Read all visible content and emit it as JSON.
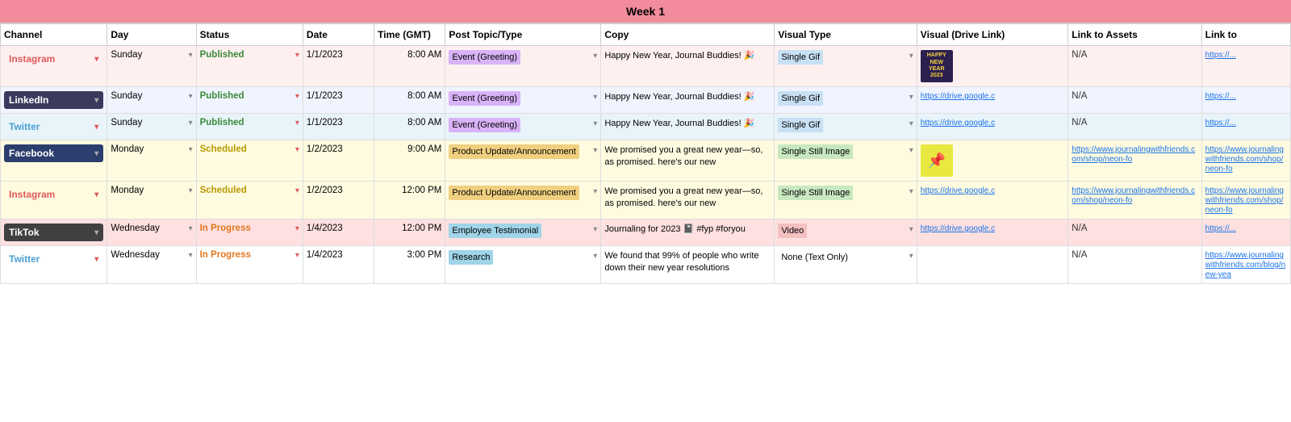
{
  "header": {
    "week_label": "Week 1"
  },
  "columns": [
    "Channel",
    "Day",
    "Status",
    "Date",
    "Time (GMT)",
    "Post Topic/Type",
    "Copy",
    "Visual Type",
    "Visual (Drive Link)",
    "Link to Assets",
    "Link to"
  ],
  "rows": [
    {
      "channel": "Instagram",
      "channel_class": "channel-instagram",
      "day": "Sunday",
      "status": "Published",
      "status_class": "status-published",
      "date": "1/1/2023",
      "time": "8:00 AM",
      "post_topic": "Event (Greeting)",
      "post_topic_class": "post-topic-event",
      "copy": "Happy New Year, Journal Buddies! 🎉",
      "visual_type": "Single Gif",
      "visual_type_class": "visual-type-gif",
      "visual_link": "",
      "visual_thumb": "2023",
      "link_to_assets": "N/A",
      "link_to": "https://...",
      "row_class": "row-instagram-1"
    },
    {
      "channel": "LinkedIn",
      "channel_class": "channel-linkedin",
      "day": "Sunday",
      "status": "Published",
      "status_class": "status-published",
      "date": "1/1/2023",
      "time": "8:00 AM",
      "post_topic": "Event (Greeting)",
      "post_topic_class": "post-topic-event",
      "copy": "Happy New Year, Journal Buddies! 🎉",
      "visual_type": "Single Gif",
      "visual_type_class": "visual-type-gif",
      "visual_link": "https://drive.google.c",
      "visual_thumb": "",
      "link_to_assets": "N/A",
      "link_to": "https://...",
      "row_class": "row-linkedin-1"
    },
    {
      "channel": "Twitter",
      "channel_class": "channel-twitter",
      "day": "Sunday",
      "status": "Published",
      "status_class": "status-published",
      "date": "1/1/2023",
      "time": "8:00 AM",
      "post_topic": "Event (Greeting)",
      "post_topic_class": "post-topic-event",
      "copy": "Happy New Year, Journal Buddies! 🎉",
      "visual_type": "Single Gif",
      "visual_type_class": "visual-type-gif",
      "visual_link": "https://drive.google.c",
      "visual_thumb": "",
      "link_to_assets": "N/A",
      "link_to": "https://...",
      "row_class": "row-twitter-1"
    },
    {
      "channel": "Facebook",
      "channel_class": "channel-facebook",
      "day": "Monday",
      "status": "Scheduled",
      "status_class": "status-scheduled",
      "date": "1/2/2023",
      "time": "9:00 AM",
      "post_topic": "Product Update/Announcement",
      "post_topic_class": "post-topic-product",
      "copy": "We promised you a great new year—so, as promised. here's our new",
      "visual_type": "Single Still Image",
      "visual_type_class": "visual-type-still",
      "visual_link": "",
      "visual_thumb": "neon",
      "link_to_assets": "https://www.journalingwithfriends.com/shop/neon-fo",
      "link_to": "https://www.journalingwithfriends.com/shop/neon-fo",
      "row_class": "row-facebook-1"
    },
    {
      "channel": "Instagram",
      "channel_class": "channel-instagram",
      "day": "Monday",
      "status": "Scheduled",
      "status_class": "status-scheduled",
      "date": "1/2/2023",
      "time": "12:00 PM",
      "post_topic": "Product Update/Announcement",
      "post_topic_class": "post-topic-product",
      "copy": "We promised you a great new year—so, as promised. here's our new",
      "visual_type": "Single Still Image",
      "visual_type_class": "visual-type-still",
      "visual_link": "https://drive.google.c",
      "visual_thumb": "",
      "link_to_assets": "https://www.journalingwithfriends.com/shop/neon-fo",
      "link_to": "https://www.journalingwithfriends.com/shop/neon-fo",
      "row_class": "row-instagram-2"
    },
    {
      "channel": "TikTok",
      "channel_class": "channel-tiktok",
      "day": "Wednesday",
      "status": "In Progress",
      "status_class": "status-inprogress",
      "date": "1/4/2023",
      "time": "12:00 PM",
      "post_topic": "Employee Testimonial",
      "post_topic_class": "post-topic-employee",
      "copy": "Journaling for 2023 📓 #fyp #foryou",
      "visual_type": "Video",
      "visual_type_class": "visual-type-video",
      "visual_link": "https://drive.google.c",
      "visual_thumb": "",
      "link_to_assets": "N/A",
      "link_to": "https://...",
      "row_class": "row-tiktok-1"
    },
    {
      "channel": "Twitter",
      "channel_class": "channel-twitter",
      "day": "Wednesday",
      "status": "In Progress",
      "status_class": "status-inprogress",
      "date": "1/4/2023",
      "time": "3:00 PM",
      "post_topic": "Research",
      "post_topic_class": "post-topic-research",
      "copy": "We found that 99% of people who write down their new year resolutions",
      "visual_type": "None (Text Only)",
      "visual_type_class": "visual-type-none",
      "visual_link": "",
      "visual_thumb": "",
      "link_to_assets": "N/A",
      "link_to": "https://www.journalingwithfriends.com/blog/new-yea",
      "row_class": "row-twitter-2"
    }
  ]
}
